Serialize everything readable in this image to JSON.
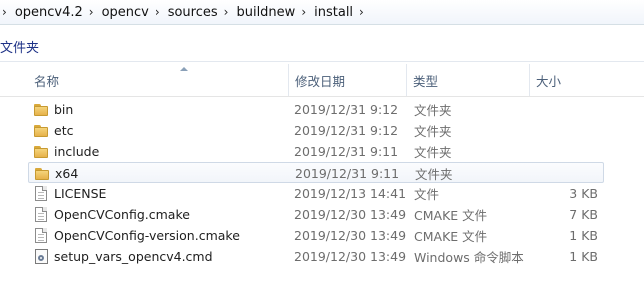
{
  "breadcrumb": {
    "items": [
      "opencv4.2",
      "opencv",
      "sources",
      "buildnew",
      "install"
    ],
    "separator": "›"
  },
  "pane": {
    "title": "文件夹"
  },
  "columns": {
    "name": "名称",
    "date": "修改日期",
    "type": "类型",
    "size": "大小"
  },
  "files": [
    {
      "name": "bin",
      "date": "2019/12/31 9:12",
      "type": "文件夹",
      "size": "",
      "icon": "folder-icon"
    },
    {
      "name": "etc",
      "date": "2019/12/31 9:12",
      "type": "文件夹",
      "size": "",
      "icon": "folder-icon"
    },
    {
      "name": "include",
      "date": "2019/12/31 9:11",
      "type": "文件夹",
      "size": "",
      "icon": "folder-icon"
    },
    {
      "name": "x64",
      "date": "2019/12/31 9:11",
      "type": "文件夹",
      "size": "",
      "icon": "folder-icon",
      "selected": true
    },
    {
      "name": "LICENSE",
      "date": "2019/12/13 14:41",
      "type": "文件",
      "size": "3 KB",
      "icon": "file-icon"
    },
    {
      "name": "OpenCVConfig.cmake",
      "date": "2019/12/30 13:49",
      "type": "CMAKE 文件",
      "size": "7 KB",
      "icon": "cmake-file-icon"
    },
    {
      "name": "OpenCVConfig-version.cmake",
      "date": "2019/12/30 13:49",
      "type": "CMAKE 文件",
      "size": "1 KB",
      "icon": "cmake-file-icon"
    },
    {
      "name": "setup_vars_opencv4.cmd",
      "date": "2019/12/30 13:49",
      "type": "Windows 命令脚本",
      "size": "1 KB",
      "icon": "cmd-script-icon"
    }
  ]
}
